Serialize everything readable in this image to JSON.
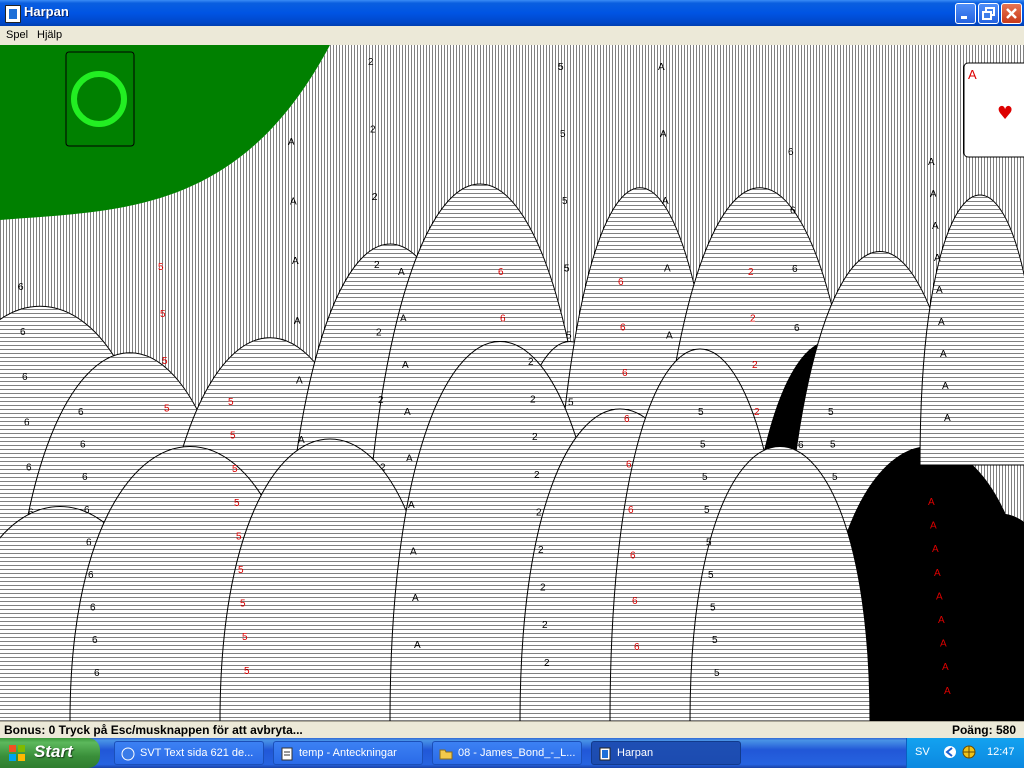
{
  "window": {
    "title": "Harpan",
    "app_icon": "card-app-icon",
    "controls": [
      "minimize-icon",
      "maximize-icon",
      "close-icon"
    ]
  },
  "menu": {
    "items": [
      "Spel",
      "Hjälp"
    ]
  },
  "game": {
    "background_color": "#008000",
    "foundation_highlight_color": "#22ee22",
    "cascade_card_ranks": [
      "A",
      "2",
      "6",
      "5"
    ],
    "cascade_card_suits": [
      "spade-icon",
      "heart-icon"
    ],
    "top_right_card": {
      "rank": "A",
      "suit": "heart-icon"
    }
  },
  "status": {
    "left_text": "Bonus: 0  Tryck på Esc/musknappen för att avbryta...",
    "right_text": "Poäng: 580"
  },
  "taskbar": {
    "start_label": "Start",
    "tasks": [
      {
        "label": "SVT Text sida 621 de...",
        "icon": "browser-icon"
      },
      {
        "label": "temp - Anteckningar",
        "icon": "notepad-icon"
      },
      {
        "label": "08 - James_Bond_-_L...",
        "icon": "folder-icon"
      },
      {
        "label": "Harpan",
        "icon": "card-app-icon"
      }
    ],
    "tray": {
      "language": "SV",
      "clock": "12:47",
      "icons": [
        "arrow-icon",
        "network-icon"
      ]
    }
  }
}
